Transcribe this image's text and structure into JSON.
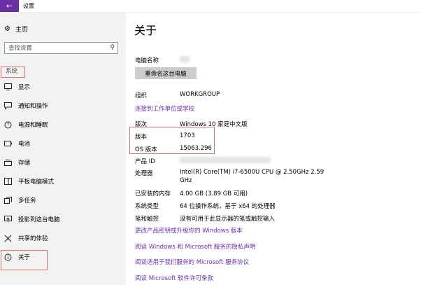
{
  "titlebar": {
    "back_icon": "←",
    "title": "设置"
  },
  "sidebar": {
    "home_label": "主页",
    "search_placeholder": "查找设置",
    "section_label": "系统",
    "items": [
      {
        "label": "显示",
        "icon": "display-icon"
      },
      {
        "label": "通知和操作",
        "icon": "notification-icon"
      },
      {
        "label": "电源和睡眠",
        "icon": "power-icon"
      },
      {
        "label": "电池",
        "icon": "battery-icon"
      },
      {
        "label": "存储",
        "icon": "storage-icon"
      },
      {
        "label": "平板电脑模式",
        "icon": "tablet-icon"
      },
      {
        "label": "多任务",
        "icon": "multitask-icon"
      },
      {
        "label": "投影到这台电脑",
        "icon": "project-icon"
      },
      {
        "label": "共享的体验",
        "icon": "share-icon"
      },
      {
        "label": "关于",
        "icon": "info-icon"
      }
    ]
  },
  "main": {
    "title": "关于",
    "pc_name_label": "电脑名称",
    "rename_button": "重命名这台电脑",
    "org_label": "组织",
    "org_value": "WORKGROUP",
    "connect_link": "连接到工作单位或学校",
    "edition_label": "版次",
    "edition_value": "Windows 10 家庭中文版",
    "version_label": "版本",
    "version_value": "1703",
    "os_build_label": "OS 版本",
    "os_build_value": "15063.296",
    "product_id_label": "产品 ID",
    "processor_label": "处理器",
    "processor_value_line1": "Intel(R) Core(TM) i7-6500U CPU @ 2.50GHz   2.59",
    "processor_value_line2": "GHz",
    "ram_label": "已安装的内存",
    "ram_value": "4.00 GB (3.89 GB 可用)",
    "system_type_label": "系统类型",
    "system_type_value": "64 位操作系统，基于 x64 的处理器",
    "pen_label": "笔和触控",
    "pen_value": "没有可用于此显示器的笔或触控输入",
    "links": [
      "更改产品密钥或升级你的 Windows 版本",
      "阅读 Windows 和 Microsoft 服务的隐私声明",
      "阅读适用于我们服务的 Microsoft 服务协议",
      "阅读 Microsoft 软件许可条款"
    ]
  }
}
